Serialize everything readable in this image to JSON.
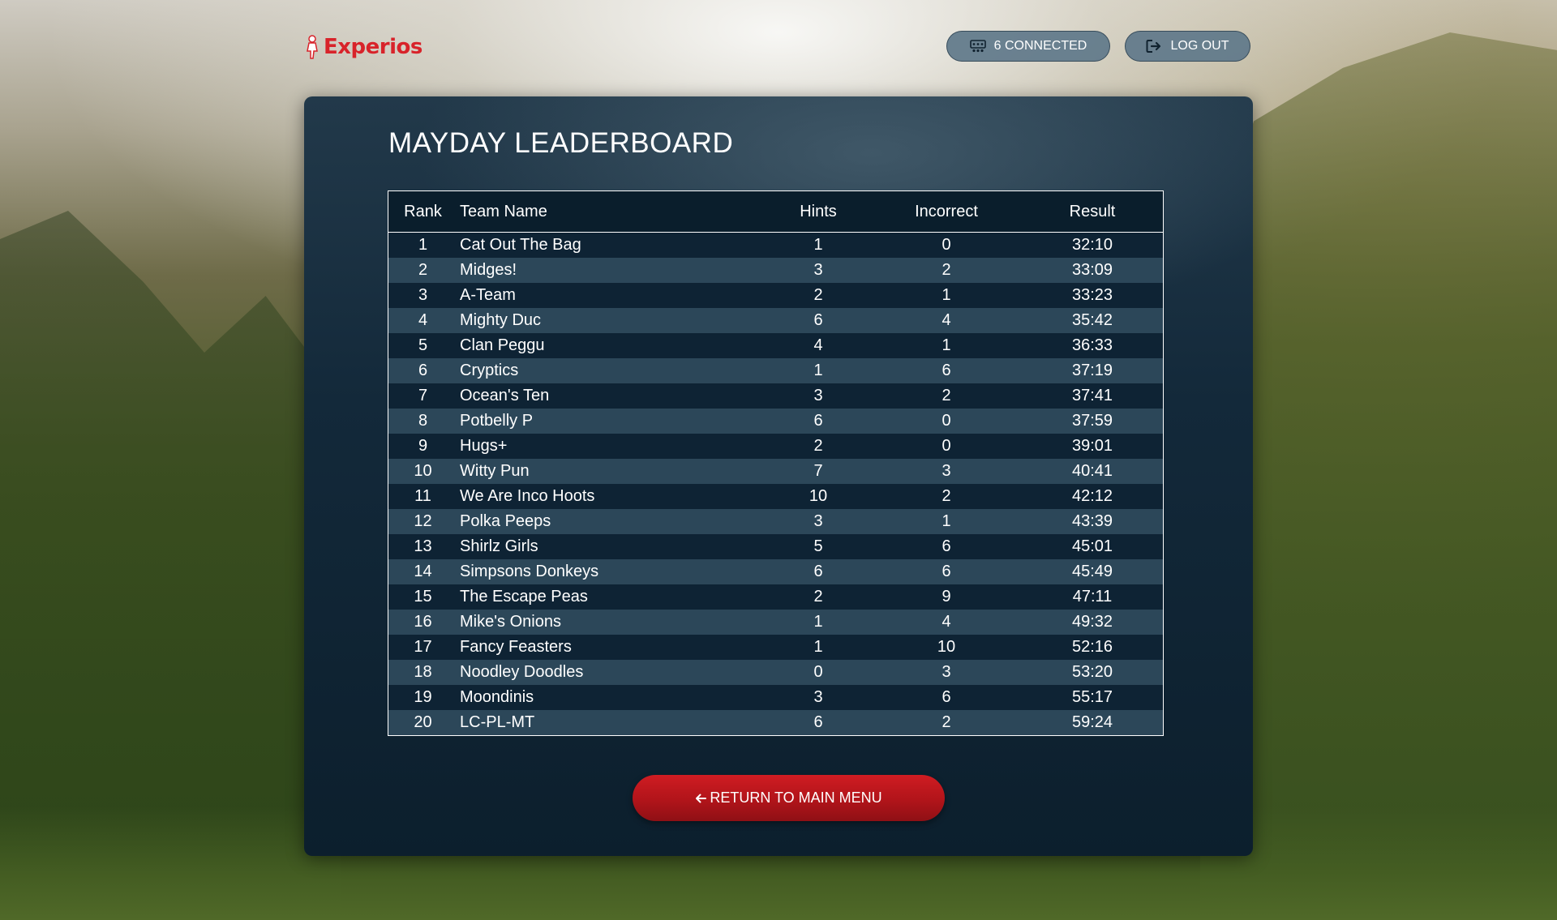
{
  "brand": {
    "name": "Experios",
    "accent_color": "#d8232a"
  },
  "header": {
    "connected_label": "6 CONNECTED",
    "connected_icon": "users-connected-icon",
    "logout_label": "LOG OUT",
    "logout_icon": "logout-icon"
  },
  "leaderboard": {
    "title": "MAYDAY LEADERBOARD",
    "columns": [
      "Rank",
      "Team Name",
      "Hints",
      "Incorrect",
      "Result"
    ],
    "rows": [
      {
        "rank": "1",
        "team": "Cat Out The Bag",
        "hints": "1",
        "incorrect": "0",
        "result": "32:10"
      },
      {
        "rank": "2",
        "team": "Midges!",
        "hints": "3",
        "incorrect": "2",
        "result": "33:09"
      },
      {
        "rank": "3",
        "team": "A-Team",
        "hints": "2",
        "incorrect": "1",
        "result": "33:23"
      },
      {
        "rank": "4",
        "team": "Mighty Duc",
        "hints": "6",
        "incorrect": "4",
        "result": "35:42"
      },
      {
        "rank": "5",
        "team": "Clan Peggu",
        "hints": "4",
        "incorrect": "1",
        "result": "36:33"
      },
      {
        "rank": "6",
        "team": "Cryptics",
        "hints": "1",
        "incorrect": "6",
        "result": "37:19"
      },
      {
        "rank": "7",
        "team": "Ocean's Ten",
        "hints": "3",
        "incorrect": "2",
        "result": "37:41"
      },
      {
        "rank": "8",
        "team": "Potbelly P",
        "hints": "6",
        "incorrect": "0",
        "result": "37:59"
      },
      {
        "rank": "9",
        "team": "Hugs+",
        "hints": "2",
        "incorrect": "0",
        "result": "39:01"
      },
      {
        "rank": "10",
        "team": "Witty Pun",
        "hints": "7",
        "incorrect": "3",
        "result": "40:41"
      },
      {
        "rank": "11",
        "team": "We Are Inco Hoots",
        "hints": "10",
        "incorrect": "2",
        "result": "42:12"
      },
      {
        "rank": "12",
        "team": "Polka Peeps",
        "hints": "3",
        "incorrect": "1",
        "result": "43:39"
      },
      {
        "rank": "13",
        "team": "Shirlz Girls",
        "hints": "5",
        "incorrect": "6",
        "result": "45:01"
      },
      {
        "rank": "14",
        "team": "Simpsons Donkeys",
        "hints": "6",
        "incorrect": "6",
        "result": "45:49"
      },
      {
        "rank": "15",
        "team": "The Escape Peas",
        "hints": "2",
        "incorrect": "9",
        "result": "47:11"
      },
      {
        "rank": "16",
        "team": "Mike's Onions",
        "hints": "1",
        "incorrect": "4",
        "result": "49:32"
      },
      {
        "rank": "17",
        "team": "Fancy Feasters",
        "hints": "1",
        "incorrect": "10",
        "result": "52:16"
      },
      {
        "rank": "18",
        "team": "Noodley Doodles",
        "hints": "0",
        "incorrect": "3",
        "result": "53:20"
      },
      {
        "rank": "19",
        "team": "Moondinis",
        "hints": "3",
        "incorrect": "6",
        "result": "55:17"
      },
      {
        "rank": "20",
        "team": "LC-PL-MT",
        "hints": "6",
        "incorrect": "2",
        "result": "59:24"
      }
    ]
  },
  "actions": {
    "return_label": "RETURN TO MAIN MENU",
    "return_icon": "arrow-left-icon",
    "return_color": "#c8191f"
  }
}
